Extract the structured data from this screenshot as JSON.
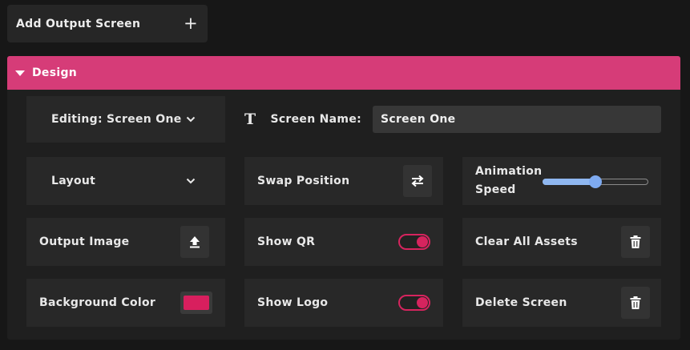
{
  "add_output": {
    "label": "Add Output Screen",
    "icon": "plus-icon"
  },
  "design": {
    "title": "Design",
    "editing_label": "Editing: Screen One",
    "screen_name_label": "Screen Name:",
    "screen_name_value": "Screen One",
    "layout_label": "Layout",
    "swap_position_label": "Swap Position",
    "animation_speed_label_line1": "Animation",
    "animation_speed_label_line2": "Speed",
    "animation_speed_value": 0.5,
    "output_image_label": "Output Image",
    "show_qr_label": "Show QR",
    "show_qr_on": true,
    "clear_assets_label": "Clear All Assets",
    "background_color_label": "Background Color",
    "background_color_value": "#d81f5e",
    "show_logo_label": "Show Logo",
    "show_logo_on": true,
    "delete_screen_label": "Delete Screen"
  },
  "colors": {
    "accent": "#d63c78",
    "toggle": "#d6245e",
    "slider": "#8fb7f0"
  }
}
